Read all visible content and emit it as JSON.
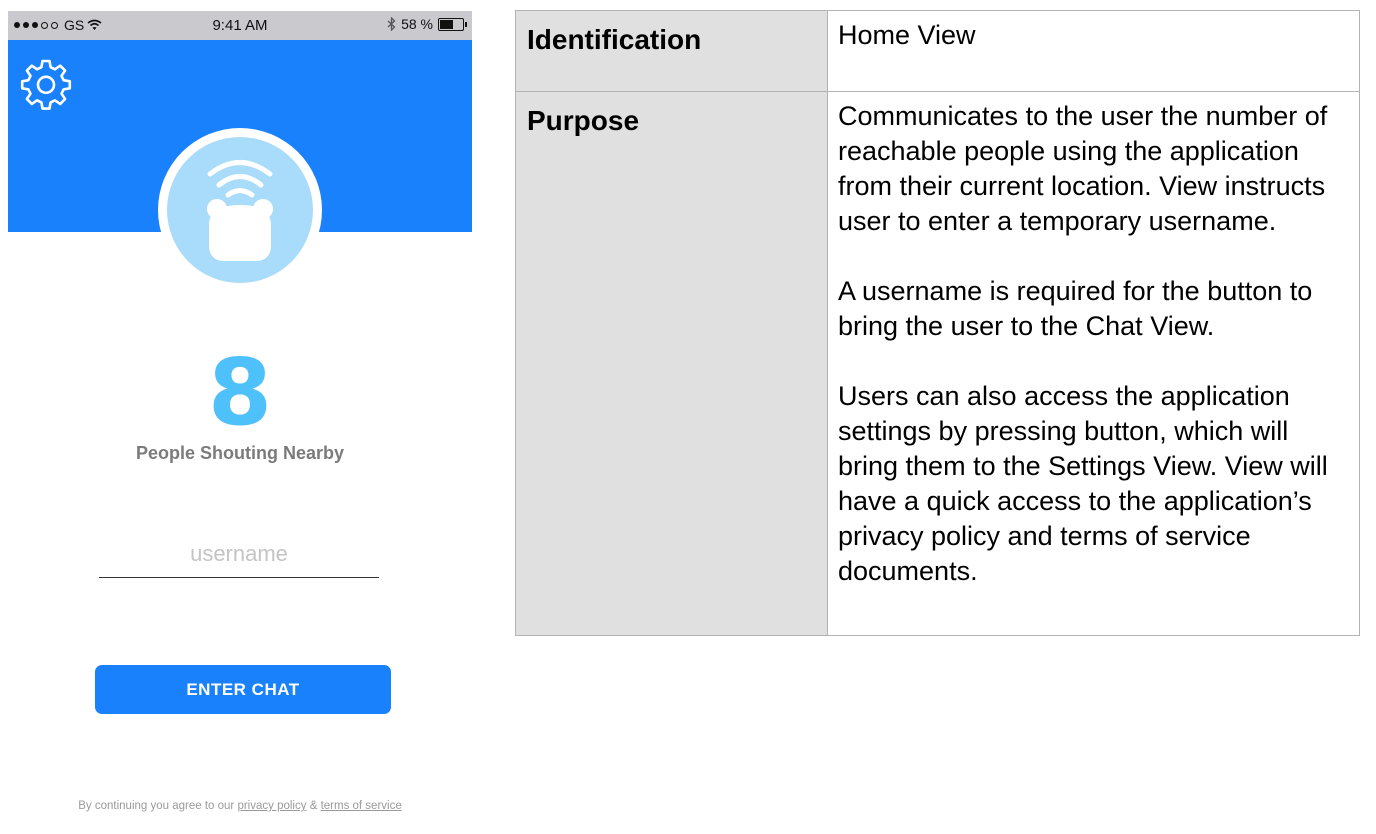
{
  "status_bar": {
    "carrier": "GS",
    "time": "9:41 AM",
    "battery": "58 %",
    "battery_level": 0.58
  },
  "header": {
    "settings_icon": "gear-icon",
    "avatar_icon": "bear-signal-icon",
    "brand_color": "#1a81fc",
    "avatar_color": "#a9dcfa"
  },
  "main": {
    "count": "8",
    "count_label": "People Shouting Nearby",
    "username_placeholder": "username",
    "enter_button": "ENTER CHAT"
  },
  "footer": {
    "prefix": "By continuing you agree to our",
    "privacy_link": "privacy policy",
    "separator": "&",
    "terms_link": "terms of service"
  },
  "spec": {
    "identification_label": "Identification",
    "identification_value": "Home View",
    "purpose_label": "Purpose",
    "purpose_paragraphs": [
      "Communicates to the user the number of reachable people using the application from their current location. View instructs user to enter a temporary username.",
      "A username is required for the button to bring the user to the Chat View.",
      "Users can also access the application settings by pressing button, which will bring them to the Settings View. View will have a quick access to the application’s privacy policy and terms of service documents."
    ]
  }
}
